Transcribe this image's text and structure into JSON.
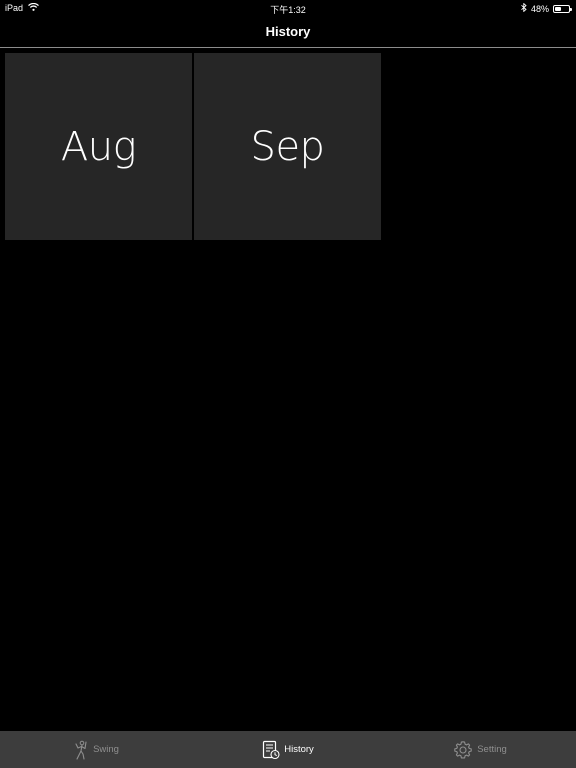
{
  "status_bar": {
    "device": "iPad",
    "time": "下午1:32",
    "battery": "48%",
    "battery_level": 0.48
  },
  "nav": {
    "title": "History"
  },
  "months": [
    {
      "label": "Aug"
    },
    {
      "label": "Sep"
    }
  ],
  "tabs": [
    {
      "label": "Swing",
      "icon": "golfer-icon",
      "active": false
    },
    {
      "label": "History",
      "icon": "history-icon",
      "active": true
    },
    {
      "label": "Setting",
      "icon": "gear-icon",
      "active": false
    }
  ],
  "colors": {
    "background": "#000000",
    "tile": "#262626",
    "tab_bar": "#3d3d3d",
    "tab_inactive": "#8f8f8f",
    "tab_active": "#ffffff"
  }
}
